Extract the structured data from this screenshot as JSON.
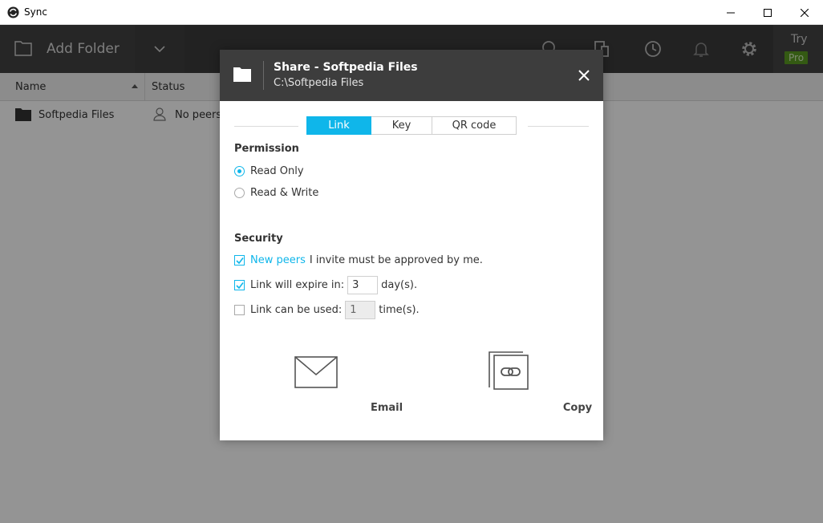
{
  "window": {
    "title": "Sync"
  },
  "toolbar": {
    "add_folder_label": "Add Folder",
    "try_label": "Try",
    "pro_label": "Pro",
    "colors": {
      "bar": "#3b3b3b",
      "pro_badge": "#5a9b21"
    }
  },
  "columns": {
    "name": "Name",
    "status": "Status"
  },
  "folders": [
    {
      "name": "Softpedia Files",
      "status": "No peers"
    }
  ],
  "dialog": {
    "title": "Share - Softpedia Files",
    "path": "C:\\Softpedia Files",
    "tabs": [
      {
        "label": "Link",
        "active": true
      },
      {
        "label": "Key",
        "active": false
      },
      {
        "label": "QR code",
        "active": false
      }
    ],
    "permission": {
      "title": "Permission",
      "options": [
        {
          "label": "Read Only",
          "selected": true
        },
        {
          "label": "Read & Write",
          "selected": false
        }
      ]
    },
    "security": {
      "title": "Security",
      "new_peers_link": "New peers",
      "new_peers_text": "I invite must be approved by me.",
      "new_peers_checked": true,
      "expire_label": "Link will expire in:",
      "expire_value": "3",
      "expire_unit": "day(s).",
      "expire_checked": true,
      "uses_label": "Link can be used:",
      "uses_value": "1",
      "uses_unit": "time(s).",
      "uses_checked": false
    },
    "actions": {
      "email_label": "Email",
      "copy_label": "Copy"
    },
    "accent_color": "#0fb6ea"
  }
}
